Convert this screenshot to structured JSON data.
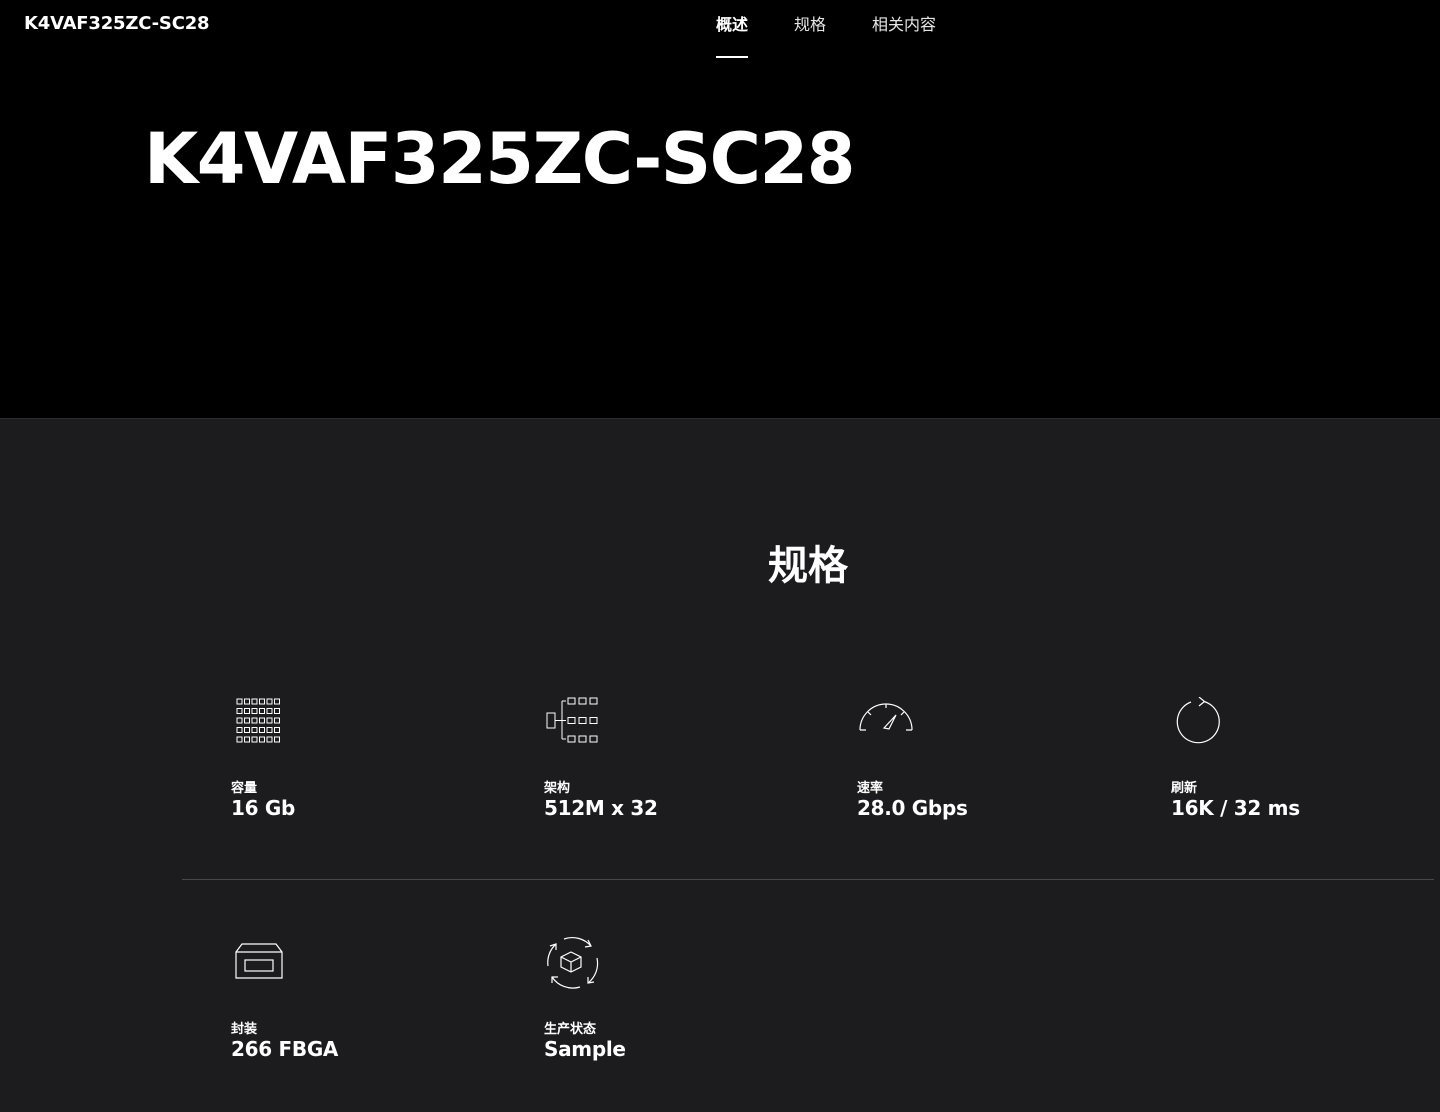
{
  "header": {
    "brand": "K4VAF325ZC-SC28",
    "tabs": [
      {
        "label": "概述",
        "active": true
      },
      {
        "label": "规格",
        "active": false
      },
      {
        "label": "相关内容",
        "active": false
      }
    ]
  },
  "hero": {
    "title": "K4VAF325ZC-SC28"
  },
  "specs": {
    "title": "规格",
    "items": [
      {
        "icon": "grid-icon",
        "label": "容量",
        "value": "16 Gb"
      },
      {
        "icon": "tree-icon",
        "label": "架构",
        "value": "512M x 32"
      },
      {
        "icon": "speedometer-icon",
        "label": "速率",
        "value": "28.0 Gbps"
      },
      {
        "icon": "refresh-icon",
        "label": "刷新",
        "value": "16K / 32 ms"
      },
      {
        "icon": "package-icon",
        "label": "封装",
        "value": "266 FBGA"
      },
      {
        "icon": "lifecycle-cube-icon",
        "label": "生产状态",
        "value": "Sample"
      }
    ]
  },
  "colors": {
    "hero_bg": "#000000",
    "body_bg": "#1c1c1e",
    "text": "#ffffff",
    "divider": "#48484a"
  }
}
